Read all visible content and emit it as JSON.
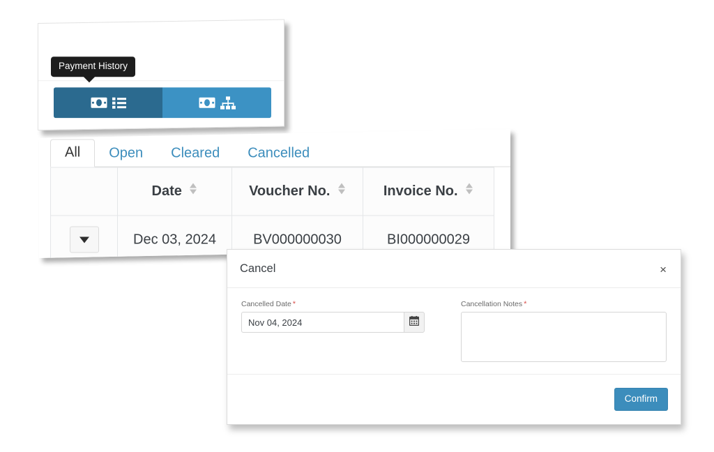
{
  "toggle_panel": {
    "tooltip": {
      "text": "Payment History"
    },
    "buttons": [
      {
        "name": "payment-history-button",
        "icons": [
          "money-bill-icon",
          "list-icon"
        ],
        "state": "active"
      },
      {
        "name": "payment-hierarchy-button",
        "icons": [
          "money-bill-icon",
          "sitemap-icon"
        ],
        "state": "inactive"
      }
    ],
    "colors": {
      "active": "#2b6a8f",
      "inactive": "#3c92c4",
      "tooltip_bg": "#1d1d1d"
    }
  },
  "table_panel": {
    "tabs": [
      {
        "label": "All",
        "active": true
      },
      {
        "label": "Open",
        "active": false
      },
      {
        "label": "Cleared",
        "active": false
      },
      {
        "label": "Cancelled",
        "active": false
      }
    ],
    "columns": [
      {
        "label": "",
        "sortable": false
      },
      {
        "label": "Date",
        "sortable": true
      },
      {
        "label": "Voucher No.",
        "sortable": true
      },
      {
        "label": "Invoice No.",
        "sortable": true
      }
    ],
    "rows": [
      {
        "expand": "row-expand-caret",
        "date": "Dec 03, 2024",
        "voucher_no": "BV000000030",
        "invoice_no": "BI000000029"
      }
    ],
    "colors": {
      "link": "#3c8dbc",
      "header_text": "#3a3f44"
    }
  },
  "modal": {
    "title": "Cancel",
    "close_label": "×",
    "fields": {
      "cancelled_date": {
        "label": "Cancelled Date",
        "required_marker": "*",
        "value": "Nov 04, 2024",
        "placeholder": "",
        "addon_icon": "calendar-icon"
      },
      "cancellation_notes": {
        "label": "Cancellation Notes",
        "required_marker": "*",
        "value": "",
        "placeholder": ""
      }
    },
    "footer": {
      "confirm_label": "Confirm"
    },
    "colors": {
      "primary": "#3c8dbc",
      "required": "#d9534f"
    }
  }
}
